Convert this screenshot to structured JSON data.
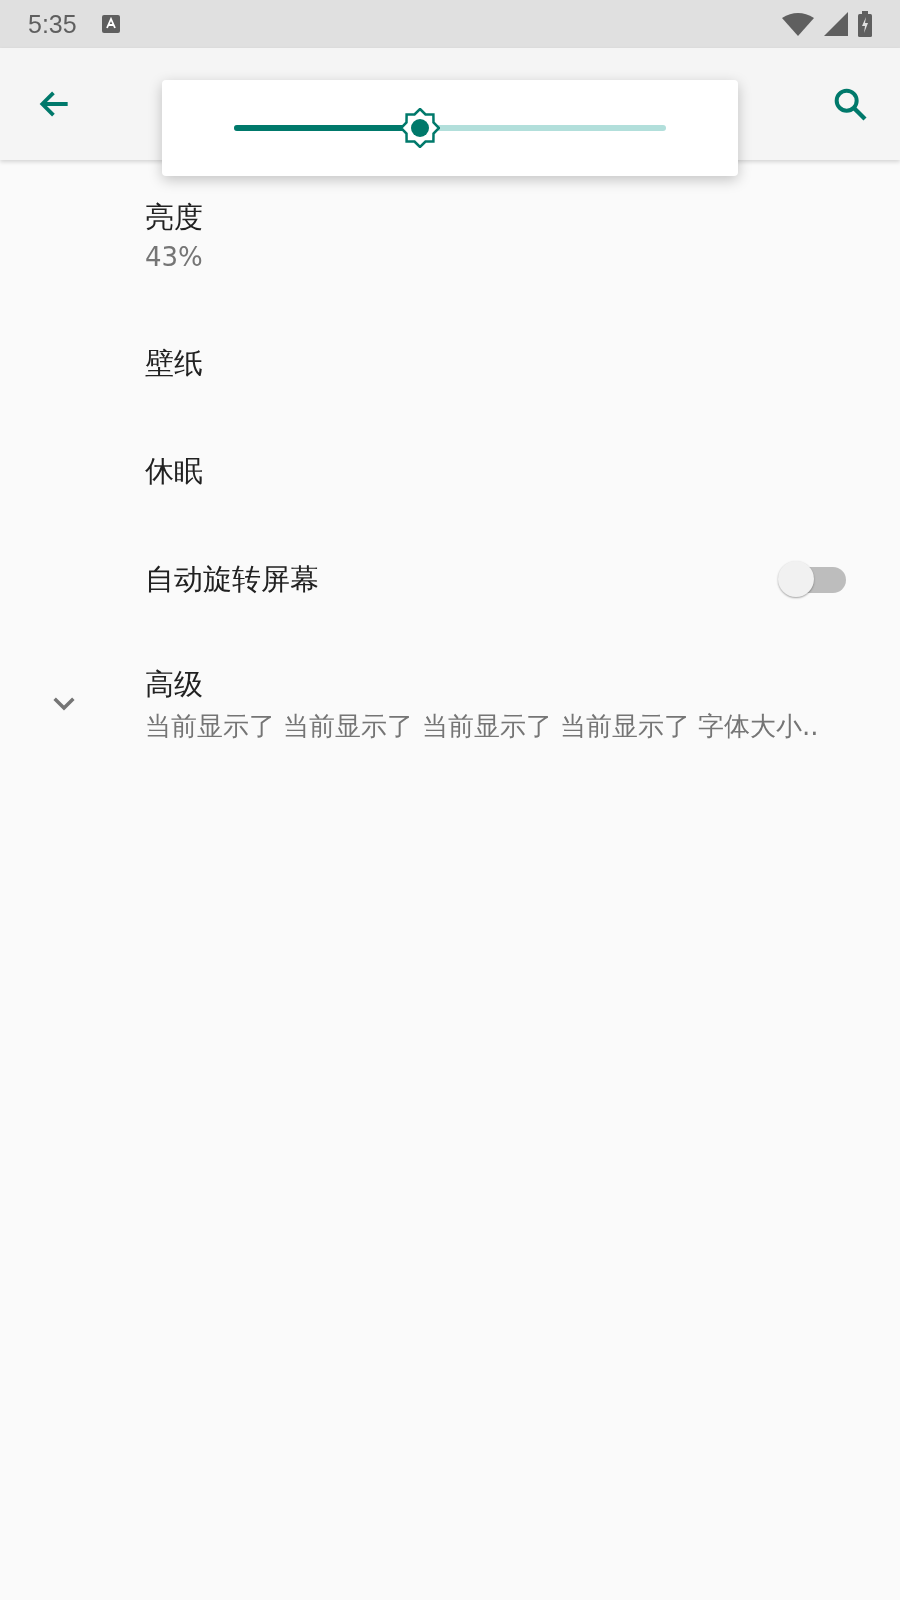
{
  "status_bar": {
    "time": "5:35"
  },
  "brightness_popup": {
    "level": 0.43
  },
  "settings": [
    {
      "kind": "summary",
      "title": "亮度",
      "summary": "43%"
    },
    {
      "kind": "plain",
      "title": "壁纸"
    },
    {
      "kind": "plain",
      "title": "休眠"
    },
    {
      "kind": "toggle",
      "title": "自动旋转屏幕",
      "on": false
    },
    {
      "kind": "expand",
      "title": "高级",
      "summary": "当前显示了 当前显示了 当前显示了 当前显示了 字体大小..",
      "expanded": false
    }
  ]
}
